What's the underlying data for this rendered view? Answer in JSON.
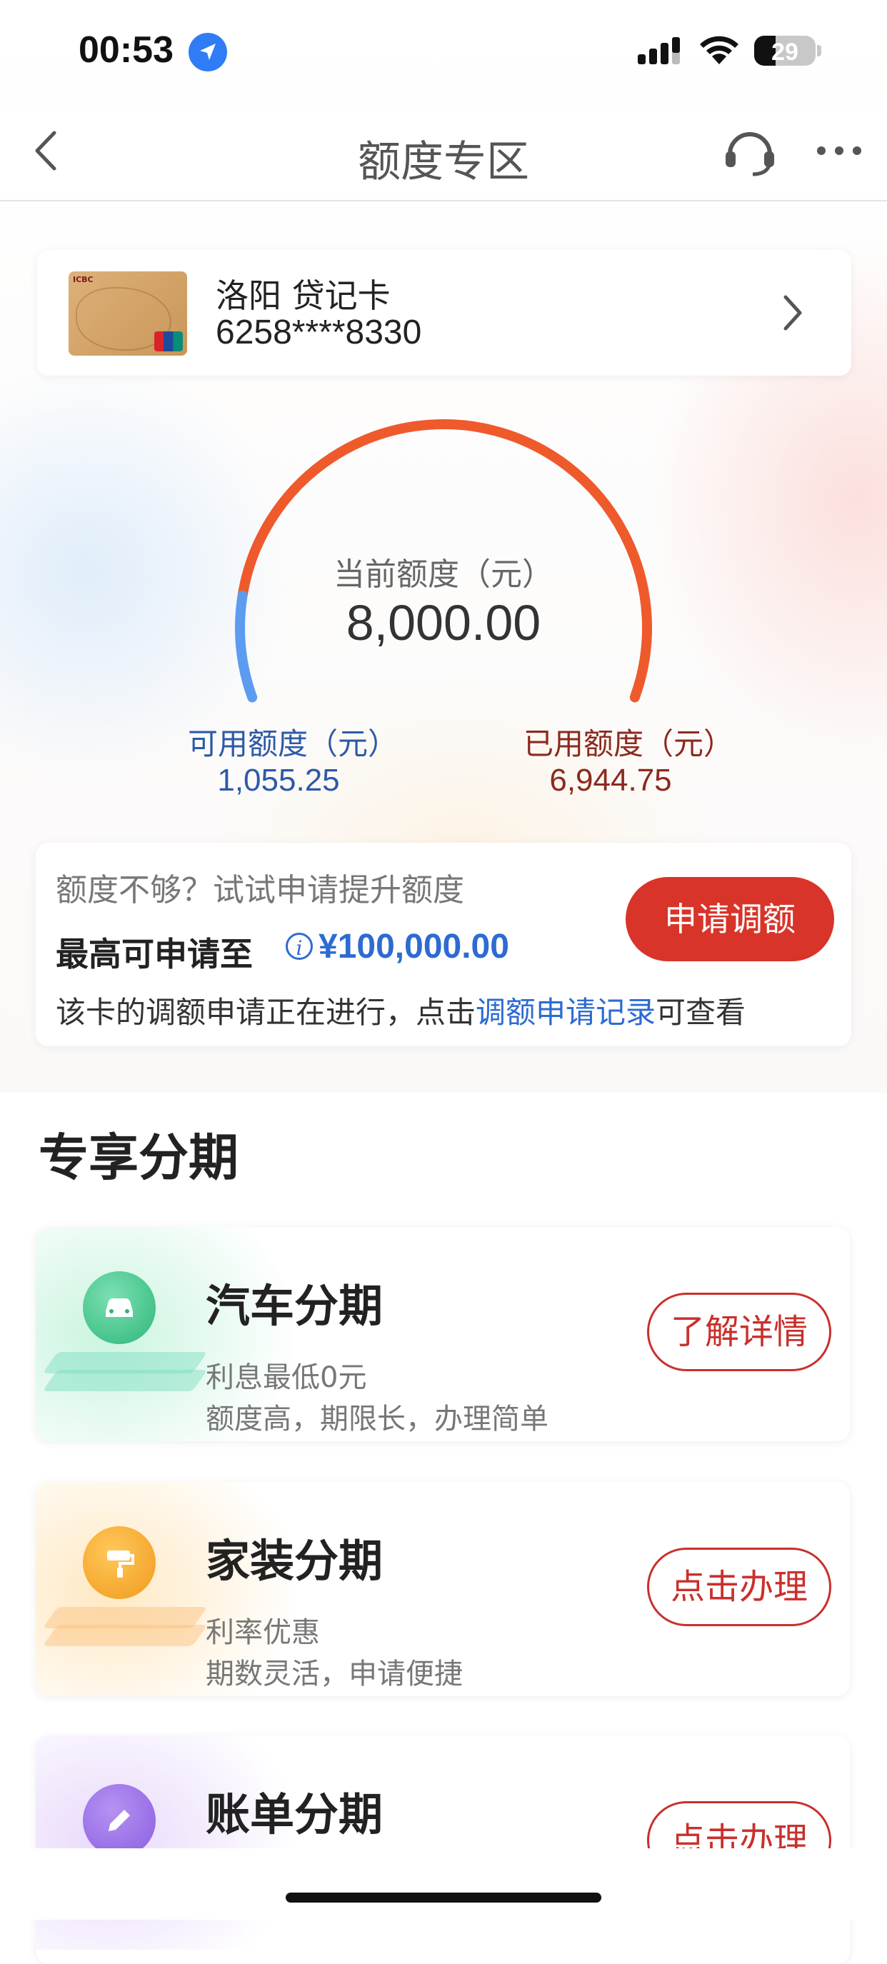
{
  "status_bar": {
    "time": "00:53",
    "battery": "29"
  },
  "nav": {
    "title": "额度专区"
  },
  "card": {
    "name": "洛阳 贷记卡",
    "number": "6258****8330"
  },
  "gauge": {
    "label": "当前额度（元）",
    "value": "8,000.00",
    "available_label": "可用额度（元）",
    "available_value": "1,055.25",
    "used_label": "已用额度（元）",
    "used_value": "6,944.75",
    "available_fraction": 0.132,
    "colors": {
      "available": "#5b9cf0",
      "used": "#ee5a2c"
    }
  },
  "raise": {
    "question": "额度不够？试试申请提升额度",
    "max_label": "最高可申请至",
    "max_value": "¥100,000.00",
    "note_prefix": "该卡的调额申请正在进行，点击",
    "note_link": "调额申请记录",
    "note_suffix": "可查看",
    "apply_label": "申请调额"
  },
  "section": {
    "title": "专享分期"
  },
  "plans": [
    {
      "title": "汽车分期",
      "sub1": "利息最低0元",
      "sub2": "额度高，期限长，办理简单",
      "button": "了解详情",
      "icon": "car-icon"
    },
    {
      "title": "家装分期",
      "sub1": "利率优惠",
      "sub2": "期数灵活，申请便捷",
      "button": "点击办理",
      "icon": "paint-roller-icon"
    },
    {
      "title": "账单分期",
      "button": "点击办理",
      "icon": "pencil-icon"
    }
  ],
  "colors": {
    "accent_red": "#d8342a",
    "link_blue": "#2d6bd2"
  }
}
